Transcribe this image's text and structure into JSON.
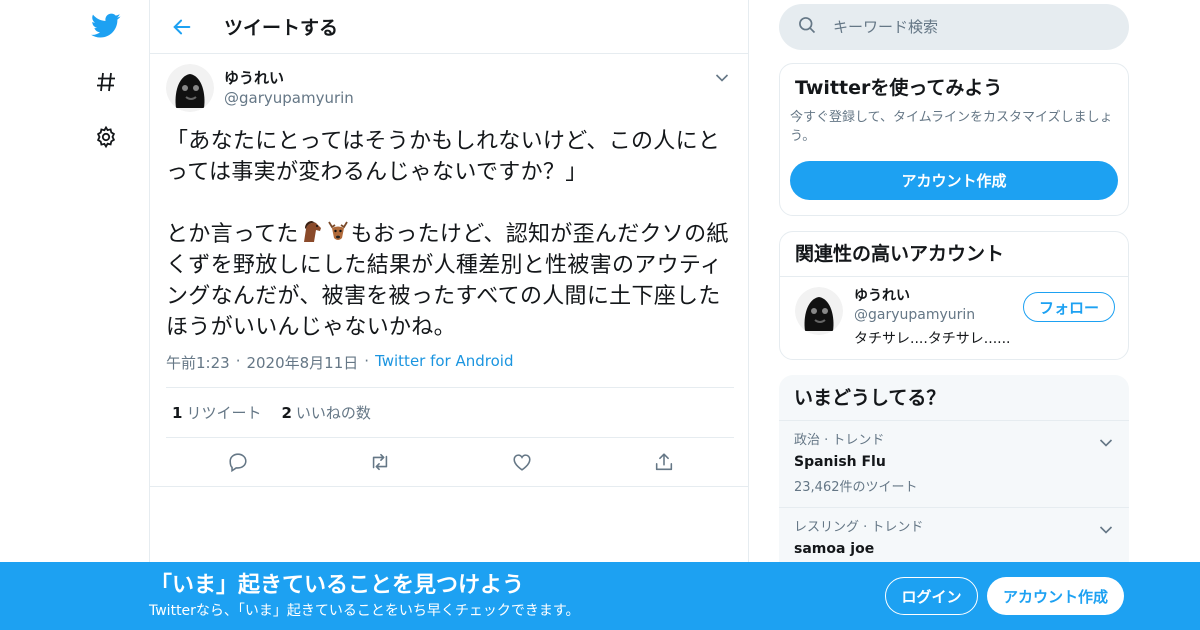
{
  "colors": {
    "accent": "#1da1f2",
    "secondary_text": "#657786",
    "divider": "#e6ecf0",
    "link": "#1b95e0"
  },
  "nav": {
    "icons": [
      "twitter-bird-icon",
      "hashtag-icon",
      "gear-icon"
    ]
  },
  "header": {
    "title": "ツイートする"
  },
  "tweet": {
    "author_name": "ゆうれい",
    "author_handle": "@garyupamyurin",
    "text_part1": "「あなたにとってはそうかもしれないけど、この人にとっては事実が変わるんじゃないですか？」\n\nとか言ってた",
    "emoji1": "🐴",
    "emoji2": "🦌",
    "text_part2": "もおったけど、認知が歪んだクソの紙くずを野放しにした結果が人種差別と性被害のアウティングなんだが、被害を被ったすべての人間に土下座したほうがいいんじゃないかね。",
    "time": "午前1:23",
    "date": "2020年8月11日",
    "source": "Twitter for Android",
    "retweet_count": "1",
    "retweet_label": "リツイート",
    "like_count": "2",
    "like_label": "いいねの数"
  },
  "search": {
    "placeholder": "キーワード検索"
  },
  "signup_card": {
    "title": "Twitterを使ってみよう",
    "description": "今すぐ登録して、タイムラインをカスタマイズしましょう。",
    "button": "アカウント作成"
  },
  "related": {
    "title": "関連性の高いアカウント",
    "account": {
      "name": "ゆうれい",
      "handle": "@garyupamyurin",
      "bio": "タチサレ....タチサレ......",
      "follow_label": "フォロー"
    }
  },
  "trends": {
    "title": "いまどうしてる？",
    "items": [
      {
        "category": "政治 · トレンド",
        "name": "Spanish Flu",
        "count": "23,462件のツイート"
      },
      {
        "category": "レスリング · トレンド",
        "name": "samoa joe",
        "count": ""
      }
    ]
  },
  "banner": {
    "title": "「いま」起きていることを見つけよう",
    "subtitle": "Twitterなら、「いま」起きていることをいち早くチェックできます。",
    "login": "ログイン",
    "signup": "アカウント作成"
  }
}
